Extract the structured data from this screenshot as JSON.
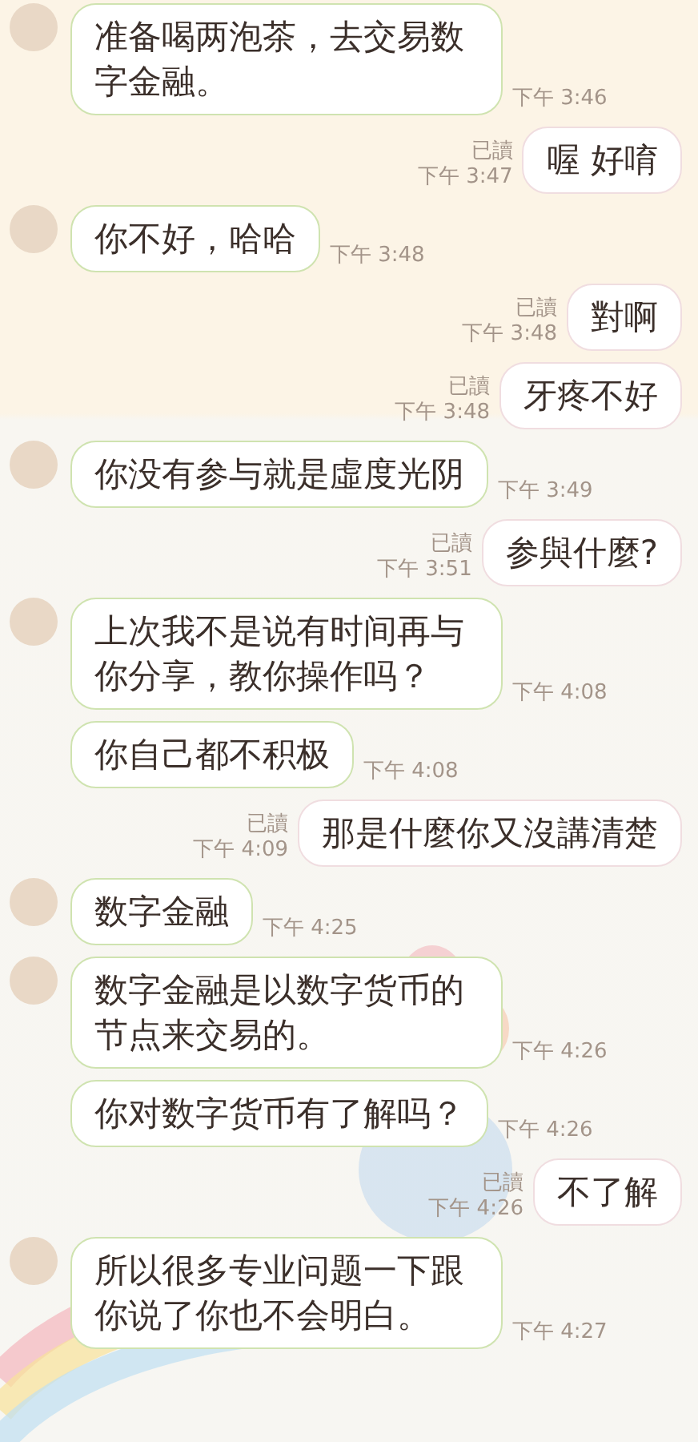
{
  "messages": [
    {
      "kind": "incoming",
      "avatar": true,
      "text": "准备喝两泡茶，去交易数字金融。",
      "time": "下午 3:46"
    },
    {
      "kind": "outgoing",
      "read": "已讀",
      "text": "喔 好唷",
      "time": "下午 3:47"
    },
    {
      "kind": "incoming",
      "avatar": true,
      "text": "你不好，哈哈",
      "time": "下午 3:48"
    },
    {
      "kind": "outgoing",
      "read": "已讀",
      "text": "對啊",
      "time": "下午 3:48"
    },
    {
      "kind": "outgoing",
      "read": "已讀",
      "text": "牙疼不好",
      "time": "下午 3:48"
    },
    {
      "kind": "incoming",
      "avatar": true,
      "text": "你没有参与就是虛度光阴",
      "time": "下午 3:49"
    },
    {
      "kind": "outgoing",
      "read": "已讀",
      "text": "参與什麼?",
      "time": "下午 3:51"
    },
    {
      "kind": "incoming",
      "avatar": true,
      "text": "上次我不是说有时间再与你分享，教你操作吗？",
      "time": "下午 4:08"
    },
    {
      "kind": "incoming",
      "avatar": false,
      "text": "你自己都不积极",
      "time": "下午 4:08"
    },
    {
      "kind": "outgoing",
      "read": "已讀",
      "text": "那是什麼你又沒講清楚",
      "time": "下午 4:09"
    },
    {
      "kind": "incoming",
      "avatar": true,
      "text": "数字金融",
      "time": "下午 4:25"
    },
    {
      "kind": "incoming",
      "avatar": true,
      "text": "数字金融是以数字货币的节点来交易的。",
      "time": "下午 4:26"
    },
    {
      "kind": "incoming",
      "avatar": false,
      "text": "你对数字货币有了解吗？",
      "time": "下午 4:26"
    },
    {
      "kind": "outgoing",
      "read": "已讀",
      "text": "不了解",
      "time": "下午 4:26"
    },
    {
      "kind": "incoming",
      "avatar": true,
      "text": "所以很多专业问题一下跟你说了你也不会明白。",
      "time": "下午 4:27"
    }
  ]
}
